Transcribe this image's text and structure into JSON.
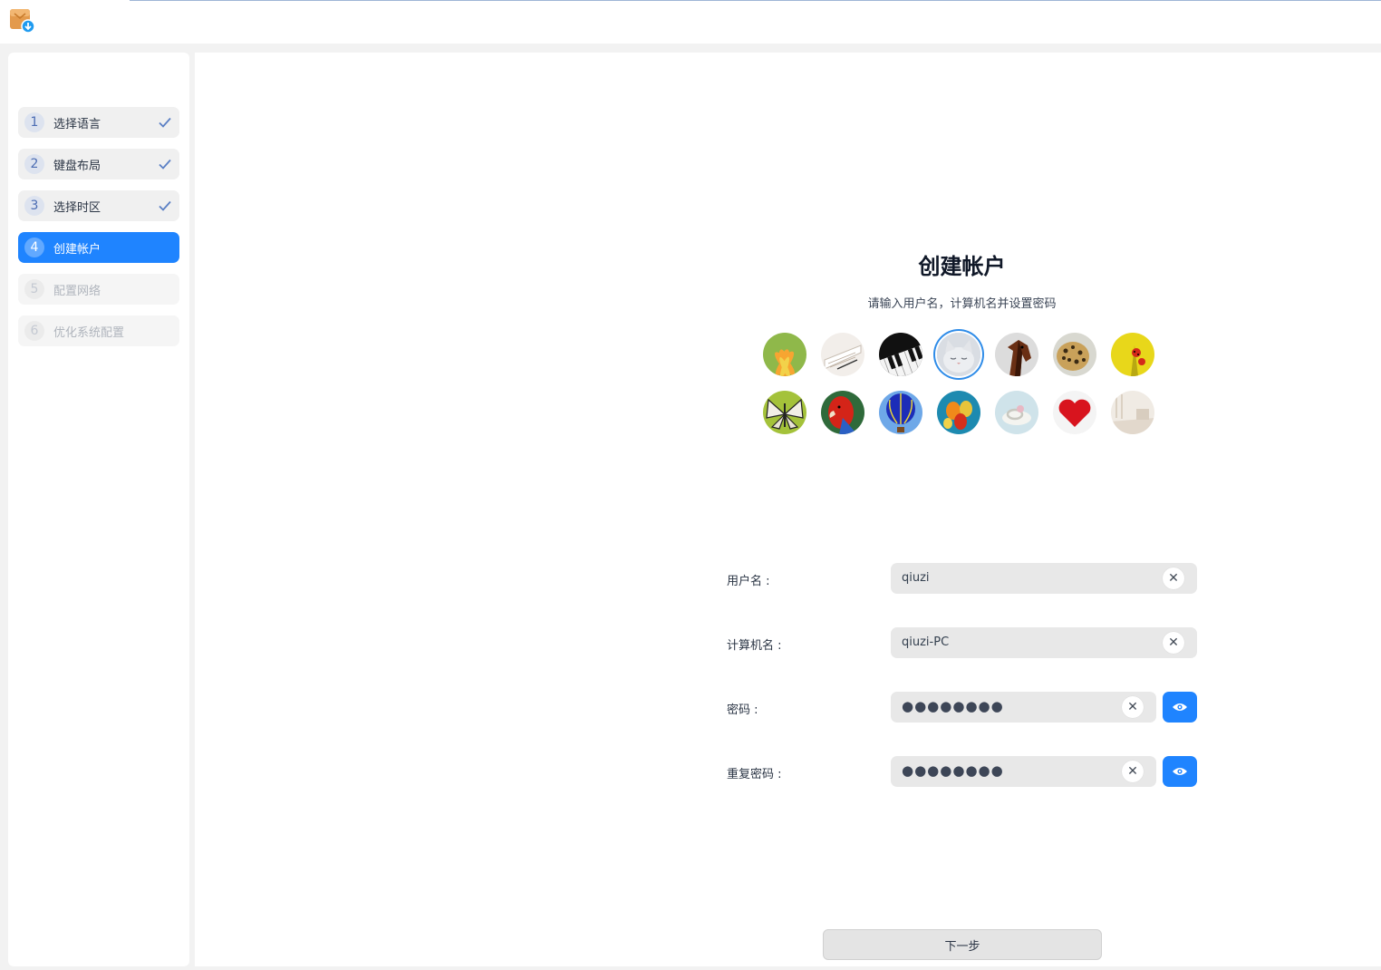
{
  "app": {
    "icon": "installer-box-icon"
  },
  "sidebar": {
    "steps": [
      {
        "num": "1",
        "label": "选择语言",
        "state": "done"
      },
      {
        "num": "2",
        "label": "键盘布局",
        "state": "done"
      },
      {
        "num": "3",
        "label": "选择时区",
        "state": "done"
      },
      {
        "num": "4",
        "label": "创建帐户",
        "state": "active"
      },
      {
        "num": "5",
        "label": "配置网络",
        "state": "disabled"
      },
      {
        "num": "6",
        "label": "优化系统配置",
        "state": "disabled"
      }
    ]
  },
  "main": {
    "title": "创建帐户",
    "subtitle": "请输入用户名，计算机名并设置密码",
    "avatars": [
      "flower-avatar",
      "notebook-avatar",
      "piano-avatar",
      "kitten-avatar",
      "horse-avatar",
      "leopard-avatar",
      "ladybug-avatar",
      "butterfly-avatar",
      "parrot-avatar",
      "balloon-avatar",
      "balloons-avatar",
      "ring-avatar",
      "heart-avatar",
      "room-avatar"
    ],
    "selected_avatar": "kitten-avatar",
    "form": {
      "username_label": "用户名 :",
      "username_value": "qiuzi",
      "hostname_label": "计算机名 :",
      "hostname_value": "qiuzi-PC",
      "password_label": "密码 :",
      "password_mask": "●●●●●●●●",
      "repeat_label": "重复密码 :",
      "repeat_mask": "●●●●●●●●",
      "clear_glyph": "✕"
    },
    "next_label": "下一步"
  },
  "colors": {
    "accent": "#1f84ff",
    "selected_ring": "#2f8ce8"
  }
}
